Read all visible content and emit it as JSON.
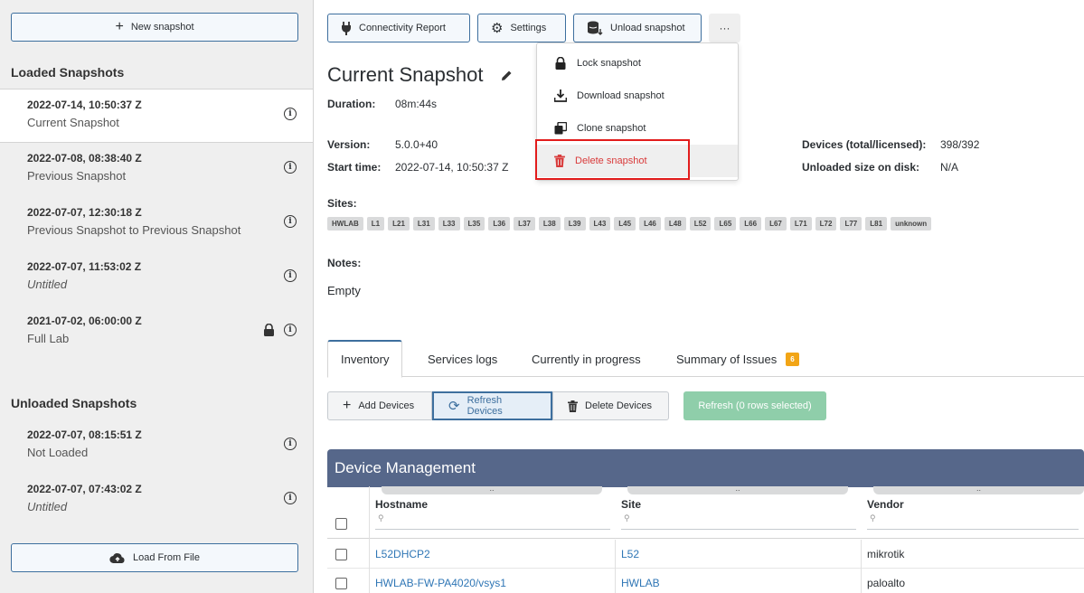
{
  "sidebar": {
    "new_snapshot_label": "New snapshot",
    "loaded_heading": "Loaded Snapshots",
    "loaded": [
      {
        "date": "2022-07-14, 10:50:37 Z",
        "name": "Current Snapshot"
      },
      {
        "date": "2022-07-08, 08:38:40 Z",
        "name": "Previous Snapshot"
      },
      {
        "date": "2022-07-07, 12:30:18 Z",
        "name": "Previous Snapshot to Previous Snapshot"
      },
      {
        "date": "2022-07-07, 11:53:02 Z",
        "name": "Untitled"
      },
      {
        "date": "2021-07-02, 06:00:00 Z",
        "name": "Full Lab"
      }
    ],
    "unloaded_heading": "Unloaded Snapshots",
    "unloaded": [
      {
        "date": "2022-07-07, 08:15:51 Z",
        "name": "Not Loaded"
      },
      {
        "date": "2022-07-07, 07:43:02 Z",
        "name": "Untitled"
      }
    ],
    "load_from_file_label": "Load From File",
    "info_glyph": "i"
  },
  "toolbar": {
    "connectivity_label": "Connectivity Report",
    "settings_label": "Settings",
    "unload_label": "Unload snapshot",
    "more_label": "···"
  },
  "dropdown": {
    "lock": "Lock snapshot",
    "download": "Download snapshot",
    "clone": "Clone snapshot",
    "delete": "Delete snapshot"
  },
  "snapshot": {
    "title": "Current Snapshot",
    "duration_label": "Duration:",
    "duration": "08m:44s",
    "version_label": "Version:",
    "version": "5.0.0+40",
    "start_label": "Start time:",
    "start": "2022-07-14, 10:50:37 Z",
    "devices_label": "Devices (total/licensed):",
    "devices": "398/392",
    "size_label": "Unloaded size on disk:",
    "size": "N/A",
    "sites_label": "Sites:",
    "sites": [
      "HWLAB",
      "L1",
      "L21",
      "L31",
      "L33",
      "L35",
      "L36",
      "L37",
      "L38",
      "L39",
      "L43",
      "L45",
      "L46",
      "L48",
      "L52",
      "L65",
      "L66",
      "L67",
      "L71",
      "L72",
      "L77",
      "L81",
      "unknown"
    ],
    "notes_label": "Notes:",
    "notes": "Empty"
  },
  "tabs": {
    "inventory": "Inventory",
    "services": "Services logs",
    "progress": "Currently in progress",
    "issues": "Summary of Issues",
    "issues_count": "6"
  },
  "actions": {
    "add": "Add Devices",
    "refresh": "Refresh Devices",
    "delete": "Delete Devices",
    "refresh_selected": "Refresh (0 rows selected)"
  },
  "grid": {
    "title": "Device Management",
    "drag_glyph": "..",
    "columns": [
      "Hostname",
      "Site",
      "Vendor"
    ],
    "rows": [
      {
        "hostname": "L52DHCP2",
        "site": "L52",
        "vendor": "mikrotik"
      },
      {
        "hostname": "HWLAB-FW-PA4020/vsys1",
        "site": "HWLAB",
        "vendor": "paloalto"
      }
    ]
  },
  "colors": {
    "accent": "#3d6f9e",
    "danger": "#d93a3a",
    "grid_header": "#56678a",
    "badge_orange": "#f2a516",
    "disabled_green": "#8fceaa"
  }
}
